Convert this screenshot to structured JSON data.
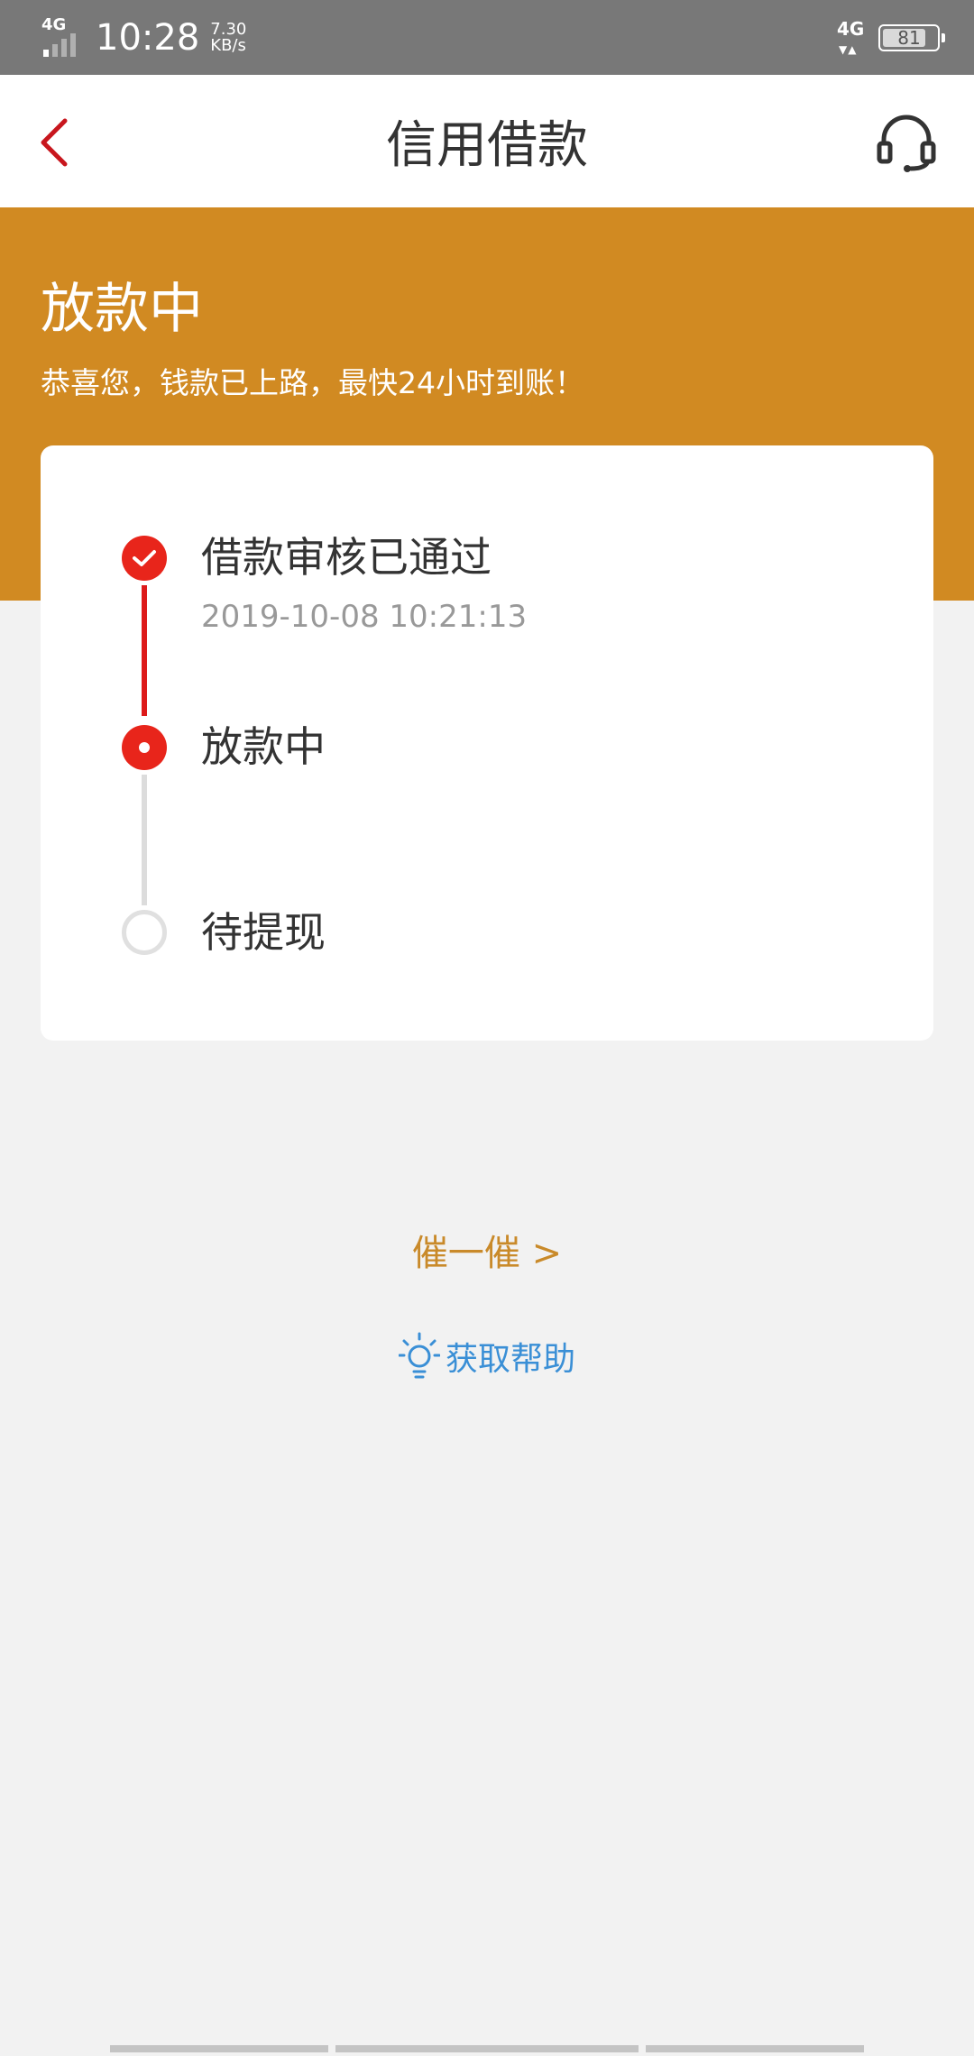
{
  "status_bar": {
    "network": "4G",
    "time": "10:28",
    "speed_value": "7.30",
    "speed_unit": "KB/s",
    "data_network": "4G",
    "battery_level": "81",
    "battery_fraction": 0.81
  },
  "nav": {
    "title": "信用借款",
    "back_icon": "chevron-left-icon",
    "support_icon": "headset-icon"
  },
  "header": {
    "title": "放款中",
    "subtitle": "恭喜您，钱款已上路，最快24小时到账！"
  },
  "progress": {
    "steps": [
      {
        "label": "借款审核已通过",
        "time": "2019-10-08 10:21:13",
        "state": "done"
      },
      {
        "label": "放款中",
        "state": "active"
      },
      {
        "label": "待提现",
        "state": "pending"
      }
    ]
  },
  "actions": {
    "urge_label": "催一催 >",
    "help_label": "获取帮助",
    "help_icon": "lightbulb-icon"
  },
  "colors": {
    "accent_orange": "#d18a22",
    "step_red": "#e8251b",
    "link_blue": "#3a8fd6",
    "urge_orange": "#c98a2a"
  }
}
